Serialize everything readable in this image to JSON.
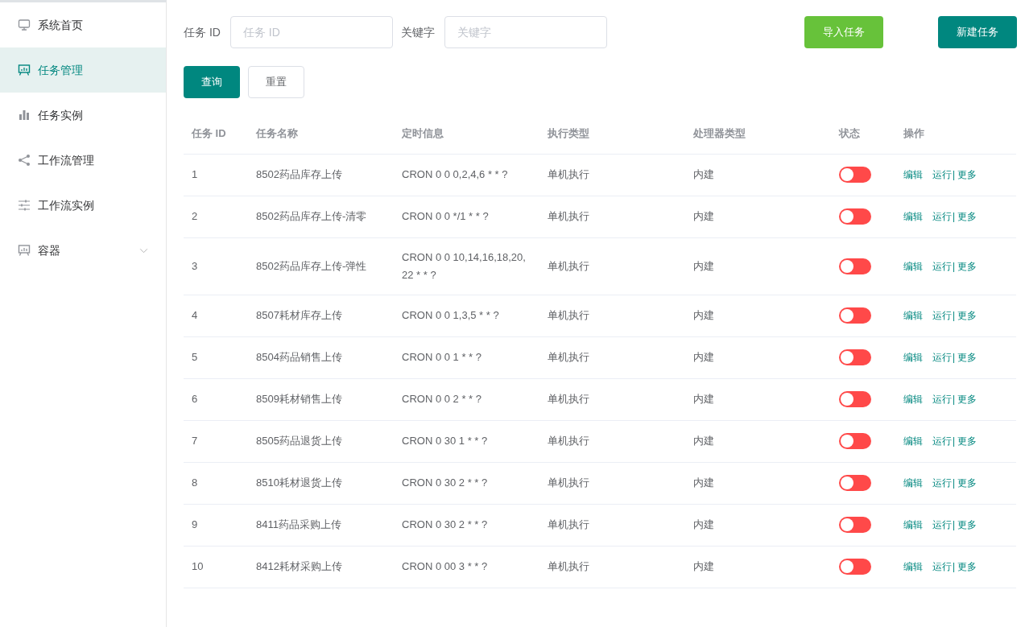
{
  "sidebar": {
    "items": [
      {
        "label": "系统首页",
        "selected": false,
        "expandable": false
      },
      {
        "label": "任务管理",
        "selected": true,
        "expandable": false
      },
      {
        "label": "任务实例",
        "selected": false,
        "expandable": false
      },
      {
        "label": "工作流管理",
        "selected": false,
        "expandable": false
      },
      {
        "label": "工作流实例",
        "selected": false,
        "expandable": false
      },
      {
        "label": "容器",
        "selected": false,
        "expandable": true
      }
    ]
  },
  "filters": [
    {
      "label": "任务 ID",
      "placeholder": "任务 ID"
    },
    {
      "label": "关键字",
      "placeholder": "关键字"
    }
  ],
  "buttons": {
    "import": "导入任务",
    "create": "新建任务",
    "query": "查询",
    "reset": "重置"
  },
  "table": {
    "columns": [
      "任务 ID",
      "任务名称",
      "定时信息",
      "执行类型",
      "处理器类型",
      "状态",
      "操作"
    ],
    "rows": [
      {
        "id": "1",
        "name": "8502药品库存上传",
        "schedule": "CRON 0 0 0,2,4,6 * * ?",
        "exec": "单机执行",
        "processor": "内建",
        "on": false,
        "actions": [
          "编辑",
          "运行",
          "|",
          "更多"
        ]
      },
      {
        "id": "2",
        "name": "8502药品库存上传-清零",
        "schedule": "CRON 0 0 */1 * * ?",
        "exec": "单机执行",
        "processor": "内建",
        "on": false,
        "actions": [
          "编辑",
          "运行",
          "|",
          "更多"
        ]
      },
      {
        "id": "3",
        "name": "8502药品库存上传-弹性",
        "schedule": "CRON 0 0 10,14,16,18,20,22 * * ?",
        "exec": "单机执行",
        "processor": "内建",
        "on": false,
        "actions": [
          "编辑",
          "运行",
          "|",
          "更多"
        ]
      },
      {
        "id": "4",
        "name": "8507耗材库存上传",
        "schedule": "CRON 0 0 1,3,5 * * ?",
        "exec": "单机执行",
        "processor": "内建",
        "on": false,
        "actions": [
          "编辑",
          "运行",
          "|",
          "更多"
        ]
      },
      {
        "id": "5",
        "name": "8504药品销售上传",
        "schedule": "CRON 0 0 1 * * ?",
        "exec": "单机执行",
        "processor": "内建",
        "on": false,
        "actions": [
          "编辑",
          "运行",
          "|",
          "更多"
        ]
      },
      {
        "id": "6",
        "name": "8509耗材销售上传",
        "schedule": "CRON 0 0 2 * * ?",
        "exec": "单机执行",
        "processor": "内建",
        "on": false,
        "actions": [
          "编辑",
          "运行",
          "|",
          "更多"
        ]
      },
      {
        "id": "7",
        "name": "8505药品退货上传",
        "schedule": "CRON 0 30 1 * * ?",
        "exec": "单机执行",
        "processor": "内建",
        "on": false,
        "actions": [
          "编辑",
          "运行",
          "|",
          "更多"
        ]
      },
      {
        "id": "8",
        "name": "8510耗材退货上传",
        "schedule": "CRON 0 30 2 * * ?",
        "exec": "单机执行",
        "processor": "内建",
        "on": false,
        "actions": [
          "编辑",
          "运行",
          "|",
          "更多"
        ]
      },
      {
        "id": "9",
        "name": "8411药品采购上传",
        "schedule": "CRON 0 30 2 * * ?",
        "exec": "单机执行",
        "processor": "内建",
        "on": false,
        "actions": [
          "编辑",
          "运行",
          "|",
          "更多"
        ]
      },
      {
        "id": "10",
        "name": "8412耗材采购上传",
        "schedule": "CRON 0 00 3 * * ?",
        "exec": "单机执行",
        "processor": "内建",
        "on": false,
        "actions": [
          "编辑",
          "运行",
          "|",
          "更多"
        ]
      }
    ]
  }
}
